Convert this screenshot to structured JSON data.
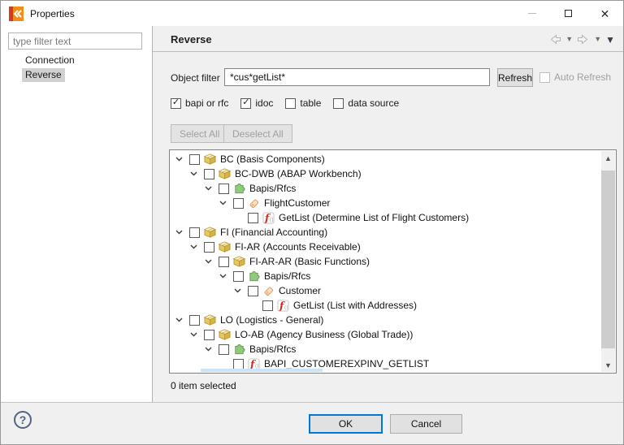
{
  "window": {
    "title": "Properties",
    "app_icon": "talend-icon",
    "controls": {
      "minimize": "minimize",
      "maximize": "maximize",
      "close": "close"
    }
  },
  "colors": {
    "accent_blue": "#0078d7",
    "panel_bg": "#f0f0f0",
    "selection_gray": "#d1d1d1",
    "partial_selection_blue": "#cbe4f7"
  },
  "sidebar": {
    "filter_placeholder": "type filter text",
    "items": [
      {
        "label": "Connection",
        "selected": false
      },
      {
        "label": "Reverse",
        "selected": true
      }
    ]
  },
  "header": {
    "title": "Reverse"
  },
  "form": {
    "object_filter_label": "Object filter",
    "object_filter_value": "*cus*getList*",
    "refresh_label": "Refresh",
    "auto_refresh_label": "Auto Refresh",
    "auto_refresh_checked": false,
    "auto_refresh_enabled": false,
    "type_filters": [
      {
        "label": "bapi or rfc",
        "checked": true
      },
      {
        "label": "idoc",
        "checked": true
      },
      {
        "label": "table",
        "checked": false
      },
      {
        "label": "data source",
        "checked": false
      }
    ],
    "select_all_label": "Select All",
    "deselect_all_label": "Deselect All",
    "select_buttons_enabled": false
  },
  "tree": {
    "items": [
      {
        "level": 0,
        "icon": "package-icon",
        "expanded": true,
        "checked": false,
        "label": "BC (Basis Components)"
      },
      {
        "level": 1,
        "icon": "package-icon",
        "expanded": true,
        "checked": false,
        "label": "BC-DWB (ABAP Workbench)"
      },
      {
        "level": 2,
        "icon": "puzzle-icon",
        "expanded": true,
        "checked": false,
        "label": "Bapis/Rfcs"
      },
      {
        "level": 3,
        "icon": "tag-icon",
        "expanded": true,
        "checked": false,
        "label": "FlightCustomer"
      },
      {
        "level": 4,
        "icon": "function-icon",
        "expanded": false,
        "checked": false,
        "label": "GetList (Determine List of Flight Customers)"
      },
      {
        "level": 0,
        "icon": "package-icon",
        "expanded": true,
        "checked": false,
        "label": "FI (Financial Accounting)"
      },
      {
        "level": 1,
        "icon": "package-icon",
        "expanded": true,
        "checked": false,
        "label": "FI-AR (Accounts Receivable)"
      },
      {
        "level": 2,
        "icon": "package-icon",
        "expanded": true,
        "checked": false,
        "label": "FI-AR-AR (Basic Functions)"
      },
      {
        "level": 3,
        "icon": "puzzle-icon",
        "expanded": true,
        "checked": false,
        "label": "Bapis/Rfcs"
      },
      {
        "level": 4,
        "icon": "tag-icon",
        "expanded": true,
        "checked": false,
        "label": "Customer"
      },
      {
        "level": 5,
        "icon": "function-icon",
        "expanded": false,
        "checked": false,
        "label": "GetList (List with Addresses)"
      },
      {
        "level": 0,
        "icon": "package-icon",
        "expanded": true,
        "checked": false,
        "label": "LO (Logistics - General)"
      },
      {
        "level": 1,
        "icon": "package-icon",
        "expanded": true,
        "checked": false,
        "label": "LO-AB (Agency Business (Global Trade))"
      },
      {
        "level": 2,
        "icon": "puzzle-icon",
        "expanded": true,
        "checked": false,
        "label": "Bapis/Rfcs"
      },
      {
        "level": 3,
        "icon": "function-icon",
        "expanded": false,
        "checked": false,
        "label": "BAPI_CUSTOMEREXPINV_GETLIST"
      }
    ]
  },
  "status_text": "0 item selected",
  "footer": {
    "help_label": "?",
    "ok_label": "OK",
    "cancel_label": "Cancel"
  }
}
